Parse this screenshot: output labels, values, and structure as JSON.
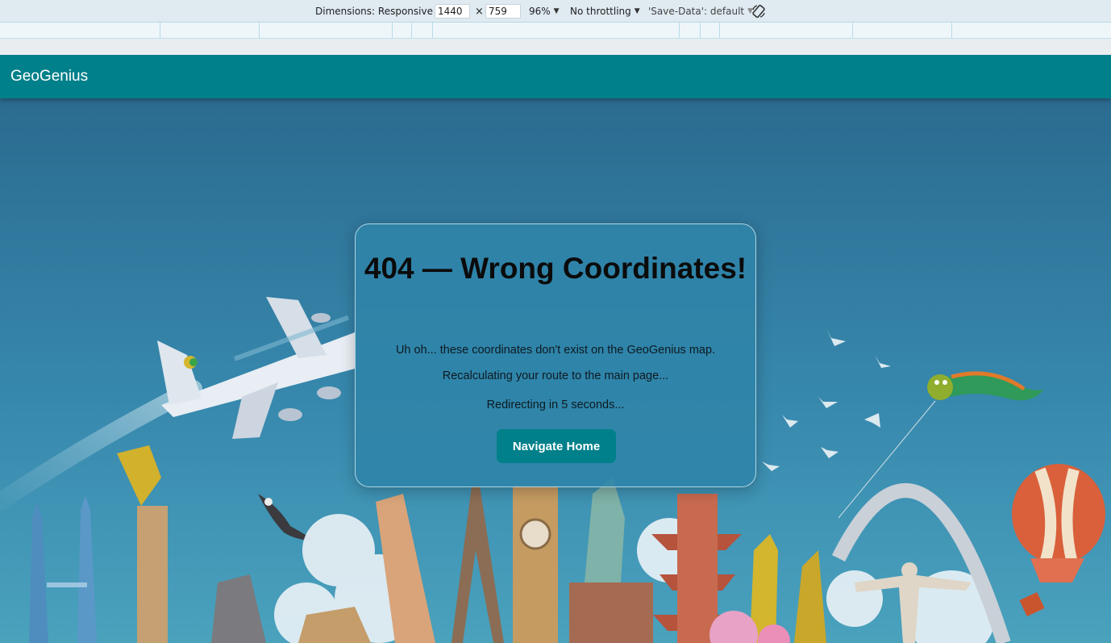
{
  "devtools": {
    "dimensions_label": "Dimensions: Responsive",
    "width_value": "1440",
    "times_sign": "×",
    "height_value": "759",
    "zoom": "96%",
    "throttling": "No throttling",
    "save_data": "'Save-Data': default",
    "rotate_icon": "rotate-icon"
  },
  "navbar": {
    "brand": "GeoGenius",
    "color": "#00808a"
  },
  "error_card": {
    "title": "404 — Wrong Coordinates!",
    "message_line1": "Uh oh... these coordinates don't exist on the GeoGenius map.",
    "message_line2": "Recalculating your route to the main page...",
    "redirect_text": "Redirecting in 5 seconds...",
    "button_label": "Navigate Home"
  },
  "colors": {
    "accent": "#00808a",
    "sky_top": "#2c6f93",
    "sky_bottom": "#3f9ab8",
    "card_bg": "#2f84a8"
  },
  "illustration": {
    "elements": [
      "airplane-icon",
      "eagle-icon",
      "birds-icon",
      "dragon-kite-icon",
      "hot-air-balloon-icon",
      "landmarks-skyline"
    ]
  }
}
